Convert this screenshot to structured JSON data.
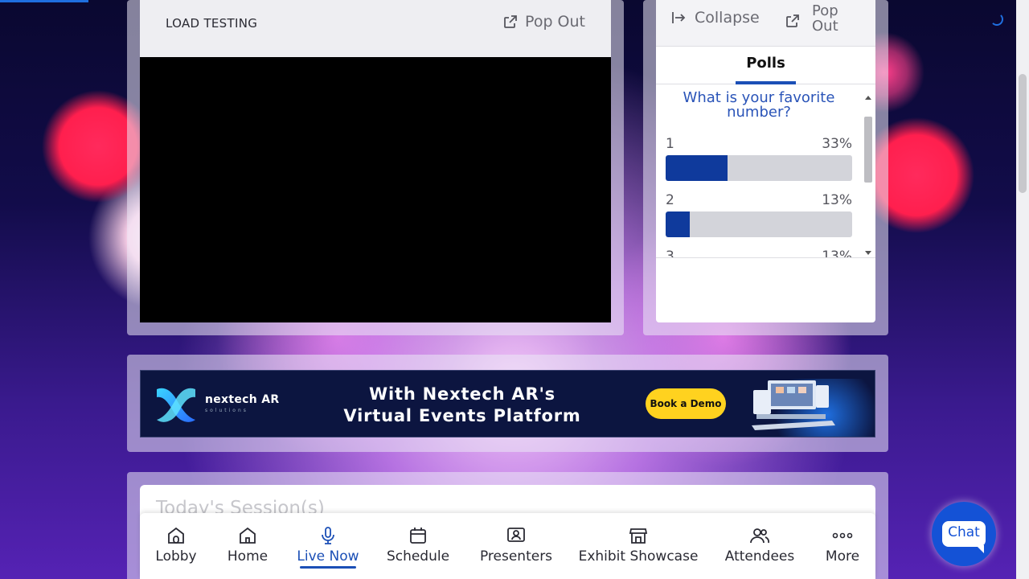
{
  "video": {
    "title": "LOAD TESTING",
    "popout_label": "Pop Out"
  },
  "polls_panel": {
    "collapse_label": "Collapse",
    "popout_label_line1": "Pop",
    "popout_label_line2": "Out",
    "tab_label": "Polls",
    "question": "What is your favorite number?",
    "options": [
      {
        "label": "1",
        "percent_text": "33%",
        "percent": 33
      },
      {
        "label": "2",
        "percent_text": "13%",
        "percent": 13
      },
      {
        "label": "3",
        "percent_text": "13%",
        "percent": 13
      }
    ]
  },
  "banner": {
    "brand_name": "nextech AR",
    "brand_sub": "solutions",
    "headline_line1": "With Nextech AR's",
    "headline_line2": "Virtual Events Platform",
    "cta_label": "Book a Demo"
  },
  "sessions": {
    "title": "Today's Session(s)"
  },
  "nav": {
    "items": [
      {
        "label": "Lobby",
        "icon": "lobby-icon"
      },
      {
        "label": "Home",
        "icon": "home-icon"
      },
      {
        "label": "Live Now",
        "icon": "microphone-icon",
        "active": true
      },
      {
        "label": "Schedule",
        "icon": "calendar-icon"
      },
      {
        "label": "Presenters",
        "icon": "presenter-icon"
      },
      {
        "label": "Exhibit Showcase",
        "icon": "storefront-icon"
      },
      {
        "label": "Attendees",
        "icon": "people-icon"
      },
      {
        "label": "More",
        "icon": "more-dots-icon"
      }
    ]
  },
  "chat": {
    "label": "Chat"
  },
  "colors": {
    "accent": "#1b4fb6",
    "poll_fill": "#0f3a9c",
    "cta_yellow": "#ffd21f",
    "chat_blue": "#1452d6"
  }
}
